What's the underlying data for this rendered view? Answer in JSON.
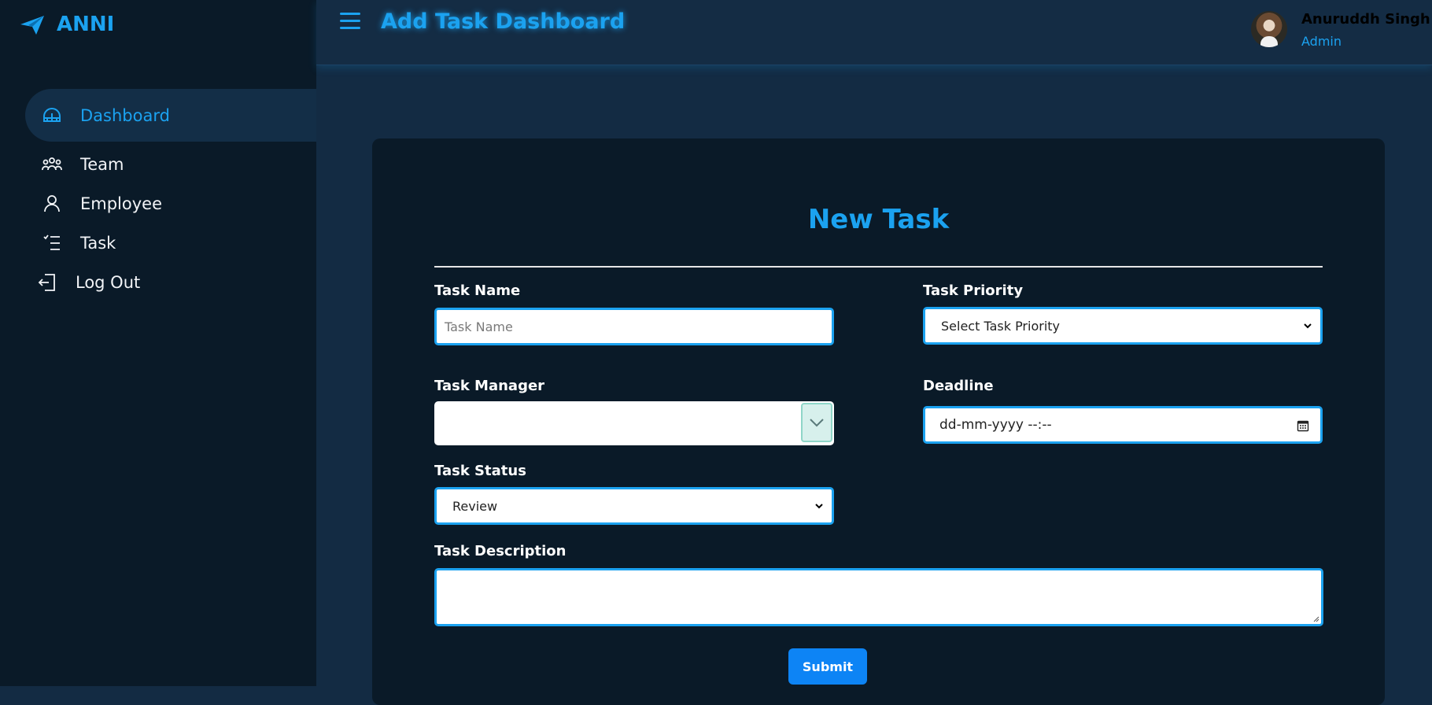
{
  "brand": {
    "name": "ANNI",
    "icon": "paper-plane-icon"
  },
  "sidebar": {
    "items": [
      {
        "label": "Dashboard",
        "icon": "dashboard-icon",
        "active": true
      },
      {
        "label": "Team",
        "icon": "team-icon",
        "active": false
      },
      {
        "label": "Employee",
        "icon": "user-icon",
        "active": false
      },
      {
        "label": "Task",
        "icon": "checklist-icon",
        "active": false
      },
      {
        "label": "Log Out",
        "icon": "logout-icon",
        "active": false
      }
    ]
  },
  "header": {
    "menu_icon": "hamburger-icon",
    "title": "Add Task Dashboard",
    "user": {
      "name": "Anuruddh Singh",
      "role": "Admin"
    }
  },
  "form": {
    "title": "New Task",
    "task_name": {
      "label": "Task Name",
      "placeholder": "Task Name",
      "value": ""
    },
    "task_priority": {
      "label": "Task Priority",
      "selected": "Select Task Priority"
    },
    "task_manager": {
      "label": "Task Manager",
      "value": ""
    },
    "deadline": {
      "label": "Deadline",
      "value": "dd-mm-yyyy --:--"
    },
    "task_status": {
      "label": "Task Status",
      "selected": "Review"
    },
    "task_description": {
      "label": "Task Description",
      "value": ""
    },
    "submit_label": "Submit"
  },
  "colors": {
    "accent": "#1ba2f0",
    "sidebar_bg": "#0a1a28",
    "page_bg": "#132b43",
    "submit_bg": "#0d84f5"
  }
}
